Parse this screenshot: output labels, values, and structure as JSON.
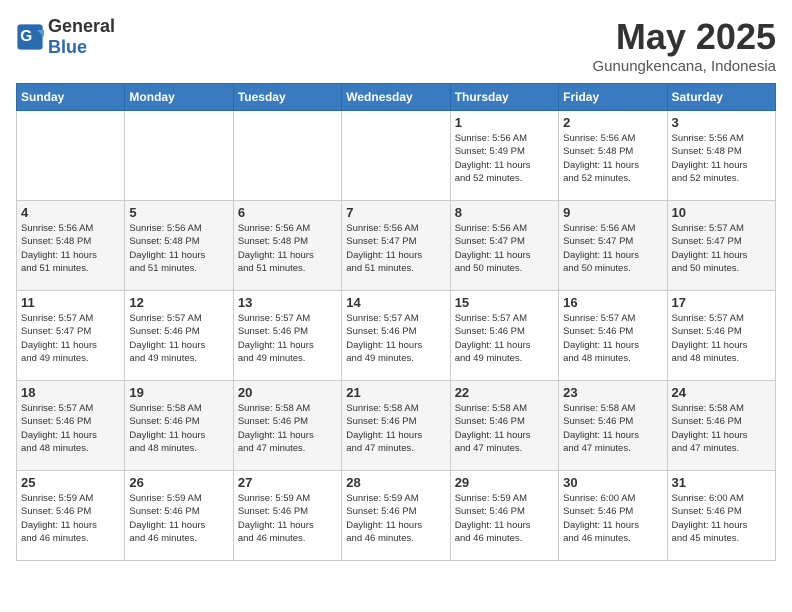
{
  "header": {
    "logo_general": "General",
    "logo_blue": "Blue",
    "month_title": "May 2025",
    "location": "Gunungkencana, Indonesia"
  },
  "days_of_week": [
    "Sunday",
    "Monday",
    "Tuesday",
    "Wednesday",
    "Thursday",
    "Friday",
    "Saturday"
  ],
  "weeks": [
    [
      {
        "day": "",
        "info": ""
      },
      {
        "day": "",
        "info": ""
      },
      {
        "day": "",
        "info": ""
      },
      {
        "day": "",
        "info": ""
      },
      {
        "day": "1",
        "info": "Sunrise: 5:56 AM\nSunset: 5:49 PM\nDaylight: 11 hours\nand 52 minutes."
      },
      {
        "day": "2",
        "info": "Sunrise: 5:56 AM\nSunset: 5:48 PM\nDaylight: 11 hours\nand 52 minutes."
      },
      {
        "day": "3",
        "info": "Sunrise: 5:56 AM\nSunset: 5:48 PM\nDaylight: 11 hours\nand 52 minutes."
      }
    ],
    [
      {
        "day": "4",
        "info": "Sunrise: 5:56 AM\nSunset: 5:48 PM\nDaylight: 11 hours\nand 51 minutes."
      },
      {
        "day": "5",
        "info": "Sunrise: 5:56 AM\nSunset: 5:48 PM\nDaylight: 11 hours\nand 51 minutes."
      },
      {
        "day": "6",
        "info": "Sunrise: 5:56 AM\nSunset: 5:48 PM\nDaylight: 11 hours\nand 51 minutes."
      },
      {
        "day": "7",
        "info": "Sunrise: 5:56 AM\nSunset: 5:47 PM\nDaylight: 11 hours\nand 51 minutes."
      },
      {
        "day": "8",
        "info": "Sunrise: 5:56 AM\nSunset: 5:47 PM\nDaylight: 11 hours\nand 50 minutes."
      },
      {
        "day": "9",
        "info": "Sunrise: 5:56 AM\nSunset: 5:47 PM\nDaylight: 11 hours\nand 50 minutes."
      },
      {
        "day": "10",
        "info": "Sunrise: 5:57 AM\nSunset: 5:47 PM\nDaylight: 11 hours\nand 50 minutes."
      }
    ],
    [
      {
        "day": "11",
        "info": "Sunrise: 5:57 AM\nSunset: 5:47 PM\nDaylight: 11 hours\nand 49 minutes."
      },
      {
        "day": "12",
        "info": "Sunrise: 5:57 AM\nSunset: 5:46 PM\nDaylight: 11 hours\nand 49 minutes."
      },
      {
        "day": "13",
        "info": "Sunrise: 5:57 AM\nSunset: 5:46 PM\nDaylight: 11 hours\nand 49 minutes."
      },
      {
        "day": "14",
        "info": "Sunrise: 5:57 AM\nSunset: 5:46 PM\nDaylight: 11 hours\nand 49 minutes."
      },
      {
        "day": "15",
        "info": "Sunrise: 5:57 AM\nSunset: 5:46 PM\nDaylight: 11 hours\nand 49 minutes."
      },
      {
        "day": "16",
        "info": "Sunrise: 5:57 AM\nSunset: 5:46 PM\nDaylight: 11 hours\nand 48 minutes."
      },
      {
        "day": "17",
        "info": "Sunrise: 5:57 AM\nSunset: 5:46 PM\nDaylight: 11 hours\nand 48 minutes."
      }
    ],
    [
      {
        "day": "18",
        "info": "Sunrise: 5:57 AM\nSunset: 5:46 PM\nDaylight: 11 hours\nand 48 minutes."
      },
      {
        "day": "19",
        "info": "Sunrise: 5:58 AM\nSunset: 5:46 PM\nDaylight: 11 hours\nand 48 minutes."
      },
      {
        "day": "20",
        "info": "Sunrise: 5:58 AM\nSunset: 5:46 PM\nDaylight: 11 hours\nand 47 minutes."
      },
      {
        "day": "21",
        "info": "Sunrise: 5:58 AM\nSunset: 5:46 PM\nDaylight: 11 hours\nand 47 minutes."
      },
      {
        "day": "22",
        "info": "Sunrise: 5:58 AM\nSunset: 5:46 PM\nDaylight: 11 hours\nand 47 minutes."
      },
      {
        "day": "23",
        "info": "Sunrise: 5:58 AM\nSunset: 5:46 PM\nDaylight: 11 hours\nand 47 minutes."
      },
      {
        "day": "24",
        "info": "Sunrise: 5:58 AM\nSunset: 5:46 PM\nDaylight: 11 hours\nand 47 minutes."
      }
    ],
    [
      {
        "day": "25",
        "info": "Sunrise: 5:59 AM\nSunset: 5:46 PM\nDaylight: 11 hours\nand 46 minutes."
      },
      {
        "day": "26",
        "info": "Sunrise: 5:59 AM\nSunset: 5:46 PM\nDaylight: 11 hours\nand 46 minutes."
      },
      {
        "day": "27",
        "info": "Sunrise: 5:59 AM\nSunset: 5:46 PM\nDaylight: 11 hours\nand 46 minutes."
      },
      {
        "day": "28",
        "info": "Sunrise: 5:59 AM\nSunset: 5:46 PM\nDaylight: 11 hours\nand 46 minutes."
      },
      {
        "day": "29",
        "info": "Sunrise: 5:59 AM\nSunset: 5:46 PM\nDaylight: 11 hours\nand 46 minutes."
      },
      {
        "day": "30",
        "info": "Sunrise: 6:00 AM\nSunset: 5:46 PM\nDaylight: 11 hours\nand 46 minutes."
      },
      {
        "day": "31",
        "info": "Sunrise: 6:00 AM\nSunset: 5:46 PM\nDaylight: 11 hours\nand 45 minutes."
      }
    ]
  ]
}
